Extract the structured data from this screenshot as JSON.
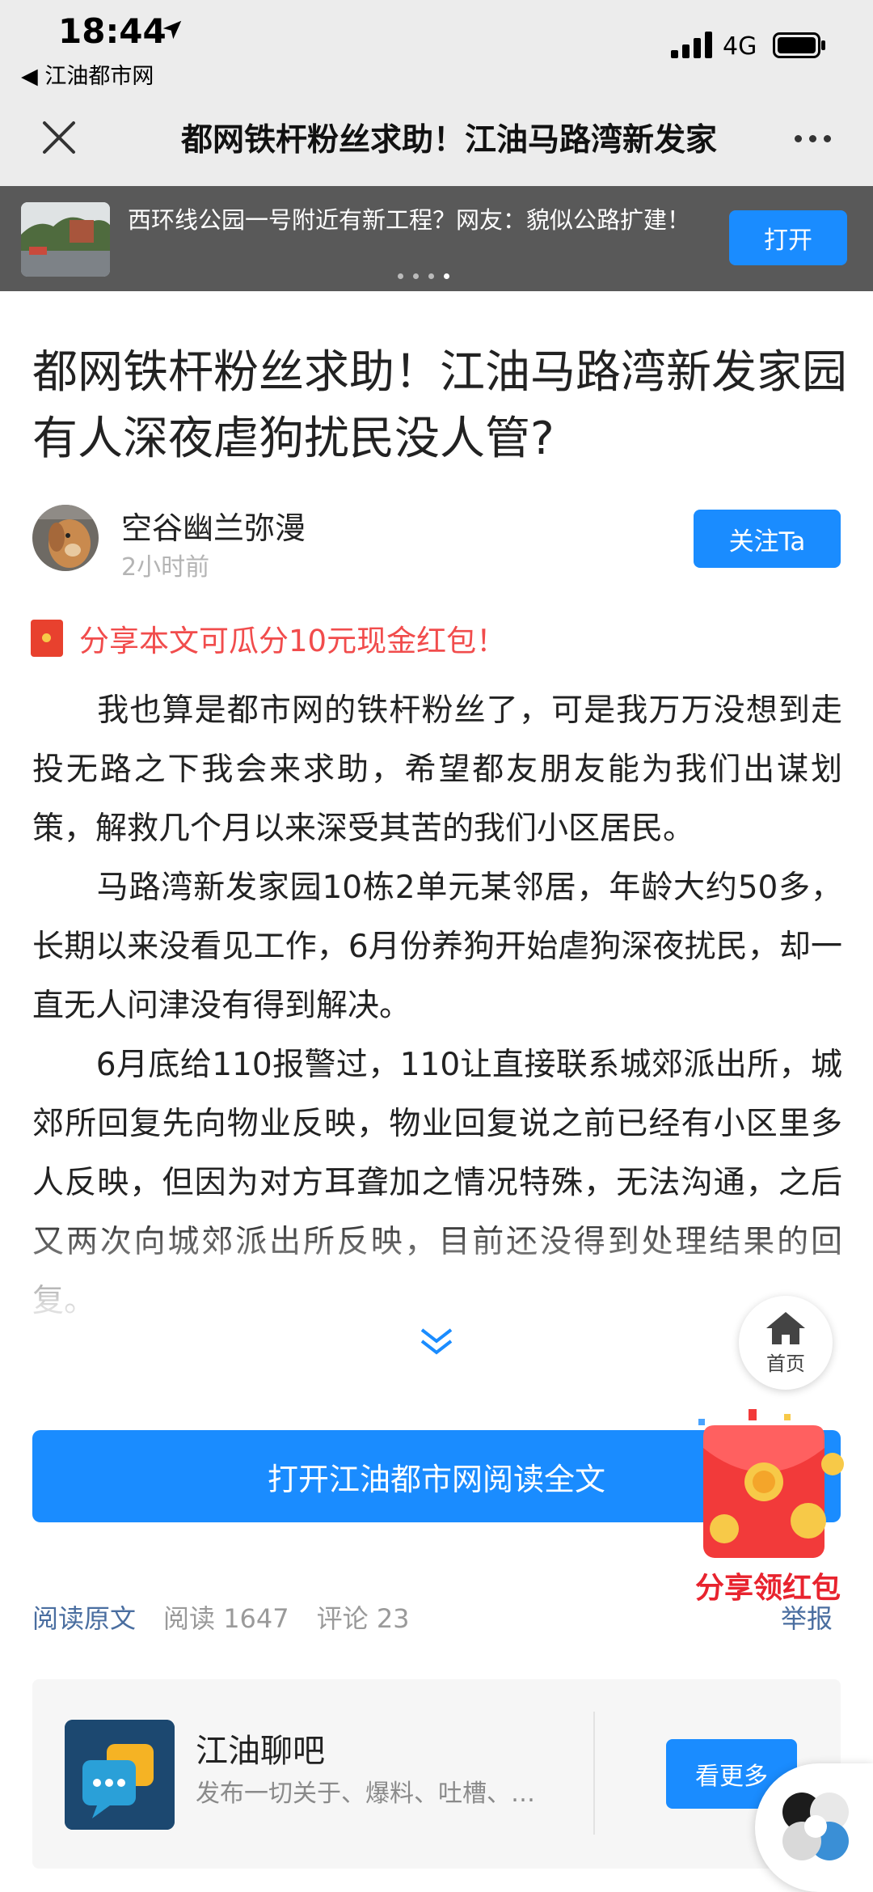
{
  "status_bar": {
    "time": "18:44",
    "back_app": "◀ 江油都市网",
    "network": "4G"
  },
  "nav": {
    "title": "都网铁杆粉丝求助！江油马路湾新发家园有人深夜虐狗扰民没人管?"
  },
  "banner": {
    "text": "西环线公园一号附近有新工程？网友：貌似公路扩建！",
    "open_label": "打开",
    "dots": 4,
    "active_dot": 3
  },
  "article": {
    "title": "都网铁杆粉丝求助！江油马路湾新发家园有人深夜虐狗扰民没人管?",
    "author": "空谷幽兰弥漫",
    "time": "2小时前",
    "follow_label": "关注Ta",
    "redpacket_notice": "分享本文可瓜分10元现金红包！",
    "paragraphs": [
      "　　我也算是都市网的铁杆粉丝了，可是我万万没想到走投无路之下我会来求助，希望都友朋友能为我们出谋划策，解救几个月以来深受其苦的我们小区居民。",
      "　　马路湾新发家园10栋2单元某邻居，年龄大约50多，长期以来没看见工作，6月份养狗开始虐狗深夜扰民，却一直无人问津没有得到解决。",
      "　　6月底给110报警过，110让直接联系城郊派出所，城郊所回复先向物业反映，物业回复说之前已经有小区里多人反映，但因为对方耳聋加之情况特殊，无法沟通，之后又两次向城郊派出所反映，目前还没得到处理结果的回复。"
    ]
  },
  "home_float": {
    "label": "首页"
  },
  "read_full_label": "打开江油都市网阅读全文",
  "float_redpacket": {
    "label": "分享领红包"
  },
  "stats": {
    "read_original": "阅读原文",
    "reads": "阅读 1647",
    "comments": "评论 23",
    "report": "举报"
  },
  "forum": {
    "name": "江油聊吧",
    "description": "发布一切关于、爆料、吐槽、…",
    "more_label": "看更多"
  },
  "colors": {
    "accent": "#1a8cff",
    "red_notice": "#f14c4c",
    "link": "#4a6ea0",
    "banner_bg": "#595959"
  },
  "icons": [
    "location-arrow-icon",
    "signal-icon",
    "battery-icon",
    "close-icon",
    "more-icon",
    "red-packet-icon",
    "expand-down-icon",
    "home-icon",
    "chat-bubble-icon",
    "pinwheel-icon"
  ]
}
